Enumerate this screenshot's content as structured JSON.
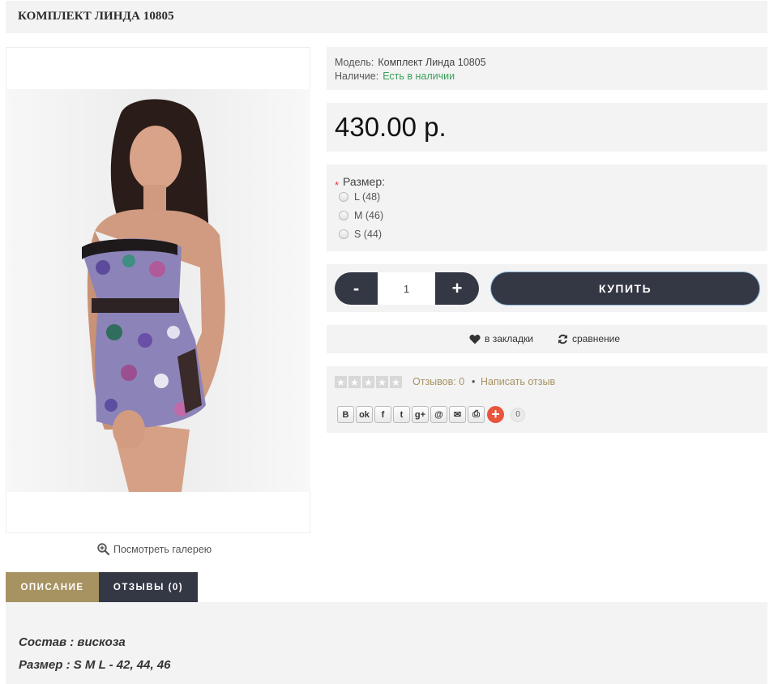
{
  "product": {
    "title": "КОМПЛЕКТ ЛИНДА 10805"
  },
  "image": {
    "gallery_link": "Посмотреть галерею"
  },
  "info": {
    "model_label": "Модель:",
    "model_value": "Комплект Линда 10805",
    "stock_label": "Наличие:",
    "stock_value": "Есть в наличии"
  },
  "price": "430.00 р.",
  "options": {
    "required_mark": "*",
    "title": "Размер:",
    "items": [
      "L (48)",
      "M (46)",
      "S (44)"
    ]
  },
  "cart": {
    "minus": "-",
    "quantity": "1",
    "plus": "+",
    "buy": "КУПИТЬ"
  },
  "actions": {
    "wishlist": "в закладки",
    "compare": "сравнение"
  },
  "review": {
    "rating": 0,
    "count_text": "Отзывов: 0",
    "separator": "•",
    "write": "Написать отзыв"
  },
  "share": {
    "buttons": [
      "В",
      "ok",
      "f",
      "t",
      "g+",
      "@",
      "✉",
      "⎙"
    ],
    "count": "0"
  },
  "tabs": {
    "description": "ОПИСАНИЕ",
    "reviews": "ОТЗЫВЫ (0)"
  },
  "description": {
    "line1": "Состав : вискоза",
    "line2": "Размер : S M L - 42, 44, 46"
  },
  "colors": {
    "accent_gold": "#a79362",
    "dark_button": "#343744",
    "stock_green": "#3aa05a",
    "panel_bg": "#f3f3f3"
  }
}
